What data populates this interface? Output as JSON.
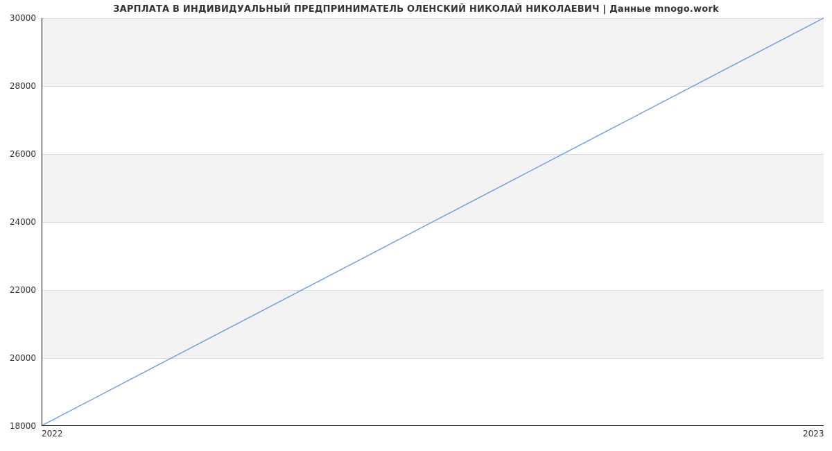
{
  "chart_data": {
    "type": "line",
    "title": "ЗАРПЛАТА В ИНДИВИДУАЛЬНЫЙ ПРЕДПРИНИМАТЕЛЬ ОЛЕНСКИЙ НИКОЛАЙ НИКОЛАЕВИЧ | Данные mnogo.work",
    "xlabel": "",
    "ylabel": "",
    "x_categories": [
      "2022",
      "2023"
    ],
    "y_ticks": [
      18000,
      20000,
      22000,
      24000,
      26000,
      28000,
      30000
    ],
    "ylim": [
      18000,
      30000
    ],
    "series": [
      {
        "name": "salary",
        "x": [
          "2022",
          "2023"
        ],
        "y": [
          18000,
          30000
        ],
        "color": "#6f9ae3"
      }
    ],
    "grid": true,
    "legend": false
  },
  "ticks": {
    "y": {
      "18000": "18000",
      "20000": "20000",
      "22000": "22000",
      "24000": "24000",
      "26000": "26000",
      "28000": "28000",
      "30000": "30000"
    },
    "x": {
      "2022": "2022",
      "2023": "2023"
    }
  }
}
